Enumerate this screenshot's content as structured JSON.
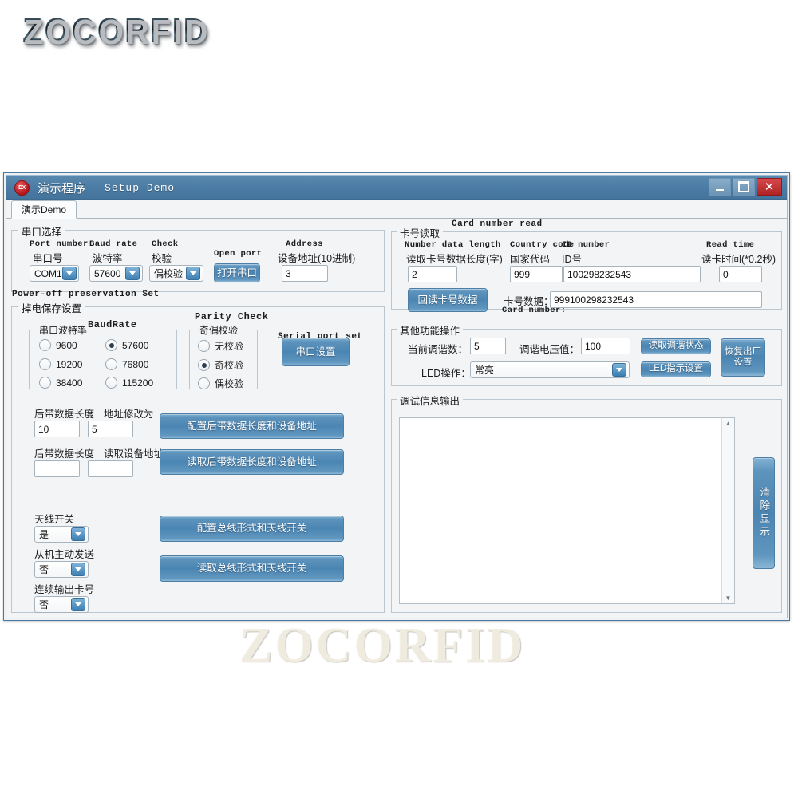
{
  "brand": {
    "logo": "ZOCORFID",
    "watermark": "ZOCORFID"
  },
  "window": {
    "icon_text": "DX",
    "title_cn": "演示程序",
    "title_en": "Setup Demo",
    "buttons": {
      "minimize": "–",
      "maximize": "❐",
      "close": "✕"
    },
    "tab": "演示Demo"
  },
  "serial_select": {
    "group_cn": "串口选择",
    "port": {
      "en": "Port number",
      "cn": "串口号",
      "value": "COM1"
    },
    "baud": {
      "en": "Baud rate",
      "cn": "波特率",
      "value": "57600"
    },
    "check": {
      "en": "Check",
      "cn": "校验",
      "value": "偶校验"
    },
    "open_port": {
      "en": "Open port",
      "cn": "打开串口"
    },
    "address": {
      "en": "Address",
      "cn": "设备地址(10进制)",
      "value": "3"
    }
  },
  "power_off": {
    "group_en": "Power-off preservation Set",
    "group_cn": "掉电保存设置",
    "baud_group": {
      "cn": "串口波特率",
      "en": "BaudRate"
    },
    "baud_options": [
      {
        "label": "9600",
        "selected": false
      },
      {
        "label": "57600",
        "selected": true
      },
      {
        "label": "19200",
        "selected": false
      },
      {
        "label": "76800",
        "selected": false
      },
      {
        "label": "38400",
        "selected": false
      },
      {
        "label": "115200",
        "selected": false
      }
    ],
    "parity_group": {
      "en": "Parity Check",
      "cn": "奇偶校验"
    },
    "parity_options": [
      {
        "label": "无校验",
        "selected": false
      },
      {
        "label": "奇校验",
        "selected": true
      },
      {
        "label": "偶校验",
        "selected": false
      }
    ],
    "serial_set_btn": {
      "en": "Serial port set",
      "cn": "串口设置"
    }
  },
  "data_addr": {
    "tail_len_label": "后带数据长度",
    "tail_len_value": "10",
    "addr_mod_label": "地址修改为",
    "addr_mod_value": "5",
    "tail_len_read_label": "后带数据长度",
    "tail_len_read_value": "",
    "addr_read_label": "读取设备地址",
    "addr_read_value": "",
    "config_btn": "配置后带数据长度和设备地址",
    "read_btn": "读取后带数据长度和设备地址"
  },
  "antenna": {
    "antenna_switch_label": "天线开关",
    "antenna_switch_value": "是",
    "slave_send_label": "从机主动发送",
    "slave_send_value": "否",
    "continuous_output_label": "连续输出卡号",
    "continuous_output_value": "否",
    "config_btn": "配置总线形式和天线开关",
    "read_btn": "读取总线形式和天线开关"
  },
  "card_read": {
    "group_cn": "卡号读取",
    "group_en": "Card number read",
    "len": {
      "en": "Number data length",
      "cn": "读取卡号数据长度(字)",
      "value": "2"
    },
    "country": {
      "en": "Country code",
      "cn": "国家代码",
      "value": "999"
    },
    "id": {
      "en": "ID number",
      "cn": "ID号",
      "value": "100298232543"
    },
    "read_time": {
      "en": "Read time",
      "cn": "读卡时间(*0.2秒)",
      "value": "0"
    },
    "readback_btn": "回读卡号数据",
    "card_num_cn": "卡号数据：",
    "card_num_en": "Card number:",
    "card_num_value": "999100298232543"
  },
  "other_func": {
    "group_cn": "其他功能操作",
    "tune_count_label": "当前调谐数：",
    "tune_count_value": "5",
    "tune_volt_label": "调谐电压值：",
    "tune_volt_value": "100",
    "led_label": "LED操作：",
    "led_value": "常亮",
    "read_tune_btn": "读取调谐状态",
    "led_set_btn": "LED指示设置",
    "factory_reset_btn": "恢复出厂\n设置"
  },
  "debug": {
    "group_cn": "调试信息输出",
    "content": "",
    "clear_btn": "清除显示",
    "scroll_up": "▲",
    "scroll_down": "▼"
  },
  "colors": {
    "title_bar": "#4a7ba4",
    "button_blue": "#4b85b2",
    "close_red": "#b02325",
    "form_bg": "#f2f4f6"
  }
}
